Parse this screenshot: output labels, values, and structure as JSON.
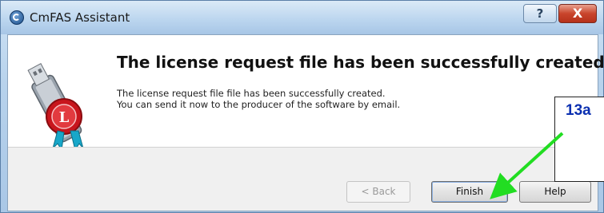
{
  "window": {
    "title": "CmFAS Assistant",
    "help_caption_glyph": "?",
    "close_glyph": "X"
  },
  "content": {
    "heading": "The license request file has been successfully created.",
    "line1": "The license request file file has been successfully created.",
    "line2": "You can send it now to the producer of the software by email."
  },
  "buttons": {
    "back": "< Back",
    "finish": "Finish",
    "help": "Help"
  },
  "annotation": {
    "label": "13a",
    "arrow_color": "#22dd22",
    "label_color": "#0a2fb0"
  },
  "icons": {
    "app": "cmfas-app-icon",
    "license": "usb-dongle-license-icon"
  }
}
